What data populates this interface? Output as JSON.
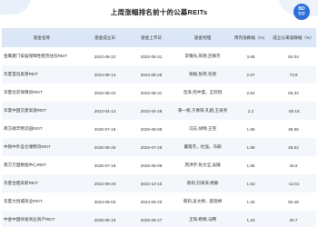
{
  "title": "上周涨幅排名前十的公募REITs",
  "logo": {
    "line1": "BD",
    "line2": "数据"
  },
  "columns": [
    "基金名称",
    "基金成立日",
    "基金上市日",
    "基金经理",
    "周内涨跌幅（%）",
    "成立以来涨跌幅（%）"
  ],
  "rows": [
    {
      "name": "金鹰厦门安居保障性租赁住房REIT",
      "established": "2022-08-22",
      "listed": "2022-08-31",
      "manager": "李耀光,蒋德,吕静杰",
      "week": "3.65",
      "since": "84.04"
    },
    {
      "name": "华夏首创奥莱REIT",
      "established": "2024-08-14",
      "listed": "2024-08-28",
      "manager": "张魁,张珂,毛晓",
      "week": "2.67",
      "since": "73.9"
    },
    {
      "name": "华夏北京保障房REIT",
      "established": "2022-08-22",
      "listed": "2022-08-31",
      "manager": "吕泽,何中盛，王欣悦",
      "week": "2.52",
      "since": "83.34"
    },
    {
      "name": "华夏中国交建高速REIT",
      "established": "2022-04-13",
      "listed": "2022-04-28",
      "manager": "黄一帆,于春阳,孔越,王泉男",
      "week": "2.2",
      "since": "-30.18"
    },
    {
      "name": "南方顺丰物流园REIT",
      "established": "2025-07-18",
      "listed": "2025-08-08",
      "manager": "冯志,胡晴,王雪",
      "week": "1.95",
      "since": "39.56"
    },
    {
      "name": "中银中外运仓储物流REIT",
      "established": "2025-06-26",
      "listed": "2025-07-29",
      "manager": "董霞杰，杜强，马颖",
      "week": "1.89",
      "since": "28.62"
    },
    {
      "name": "南方万国数据中心REIT",
      "established": "2025-07-18",
      "listed": "2025-08-08",
      "manager": "周洪宇,张文全,吴珊",
      "week": "1.65",
      "since": "45.6"
    },
    {
      "name": "华夏合肥高新REIT",
      "established": "2022-09-20",
      "listed": "2022-10-10",
      "manager": "蔡莉,刘泽涛,杨静",
      "week": "1.53",
      "since": "-12.51"
    },
    {
      "name": "华夏大悦城商业REIT",
      "established": "2024-09-03",
      "listed": "2024-09-20",
      "manager": "蔡莉,吴文婷，庭晓婷",
      "week": "1.32",
      "since": "50.48"
    },
    {
      "name": "中金中国绿发商业资产REIT",
      "established": "2025-06-19",
      "listed": "2025-06-27",
      "manager": "王琛,杨畅,马腾",
      "week": "1.23",
      "since": "30.7"
    }
  ]
}
